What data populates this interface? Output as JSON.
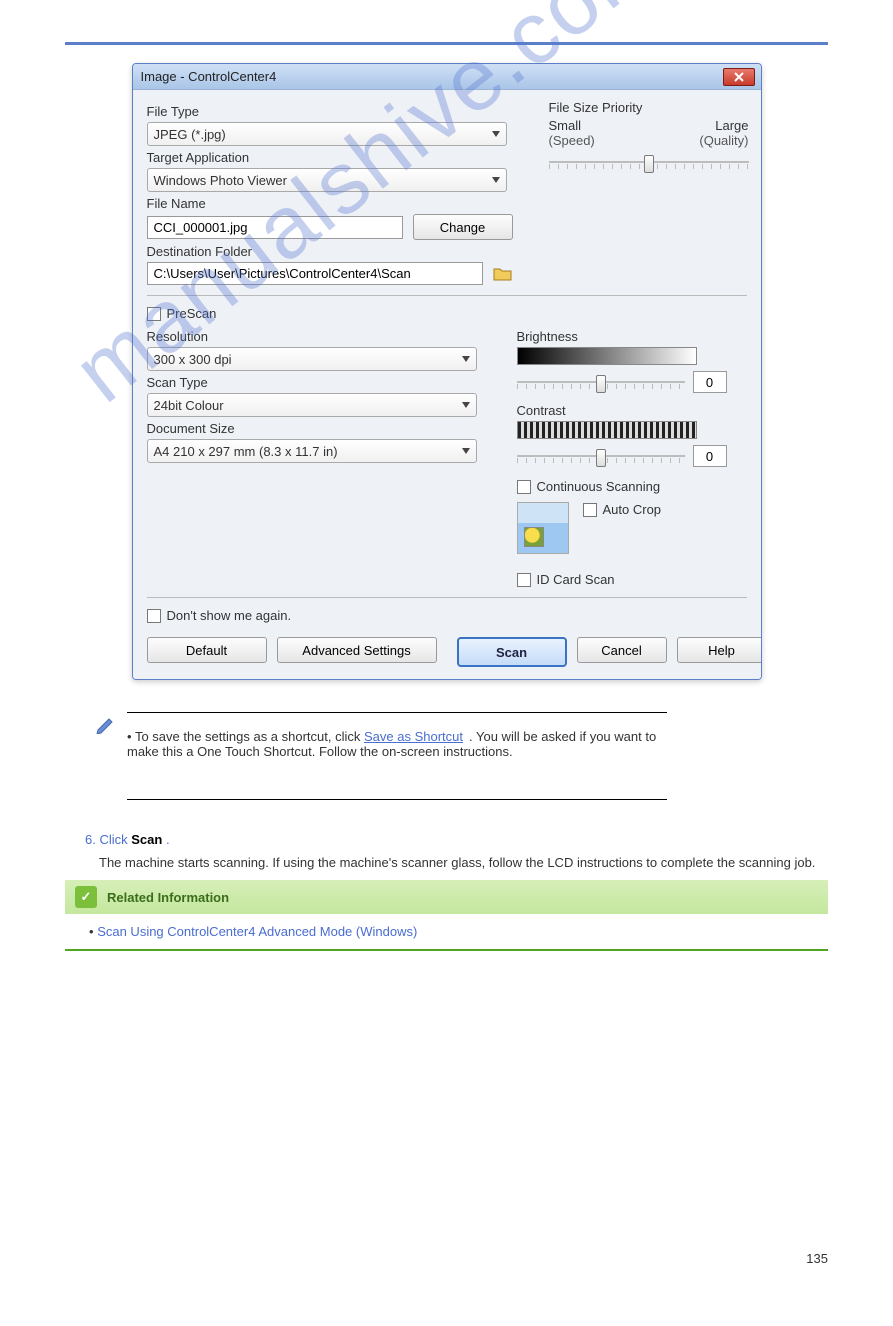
{
  "dialog": {
    "title": "Image - ControlCenter4",
    "close_icon": "close-icon",
    "file_type_label": "File Type",
    "file_type_value": "JPEG (*.jpg)",
    "target_app_label": "Target Application",
    "target_app_value": "Windows Photo Viewer",
    "file_name_label": "File Name",
    "file_name_value": "CCI_000001.jpg",
    "change_btn": "Change",
    "dest_folder_label": "Destination Folder",
    "dest_folder_value": "C:\\Users\\User\\Pictures\\ControlCenter4\\Scan",
    "prescan_label": "PreScan",
    "resolution_label": "Resolution",
    "resolution_value": "300 x 300 dpi",
    "scan_type_label": "Scan Type",
    "scan_type_value": "24bit Colour",
    "doc_size_label": "Document Size",
    "doc_size_value": "A4 210 x 297 mm (8.3 x 11.7 in)",
    "brightness_label": "Brightness",
    "brightness_value": "0",
    "contrast_label": "Contrast",
    "contrast_value": "0",
    "file_size_priority_label": "File Size Priority",
    "fsp_small": "Small",
    "fsp_large": "Large",
    "fsp_speed": "(Speed)",
    "fsp_quality": "(Quality)",
    "continuous_scan": "Continuous Scanning",
    "auto_crop": "Auto Crop",
    "id_card_scan": "ID Card Scan",
    "dont_show": "Don't show me again.",
    "btn_default": "Default",
    "btn_advanced": "Advanced Settings",
    "btn_scan": "Scan",
    "btn_cancel": "Cancel",
    "btn_help": "Help"
  },
  "note": {
    "bullet": "•",
    "text_before": "To save the settings as a shortcut, click ",
    "link": "Save as Shortcut",
    "text_after": ". You will be asked if you want to make this a One Touch Shortcut. Follow the on-screen instructions."
  },
  "step6": {
    "num": "6. ",
    "text_before": "Click ",
    "bold": "Scan",
    "text_after": "."
  },
  "related": {
    "title": "Related Information",
    "item_bullet": "•",
    "item_text": "Scan Using ControlCenter4 Advanced Mode (Windows)"
  },
  "page_number": "135",
  "watermark": "manualshive.com"
}
